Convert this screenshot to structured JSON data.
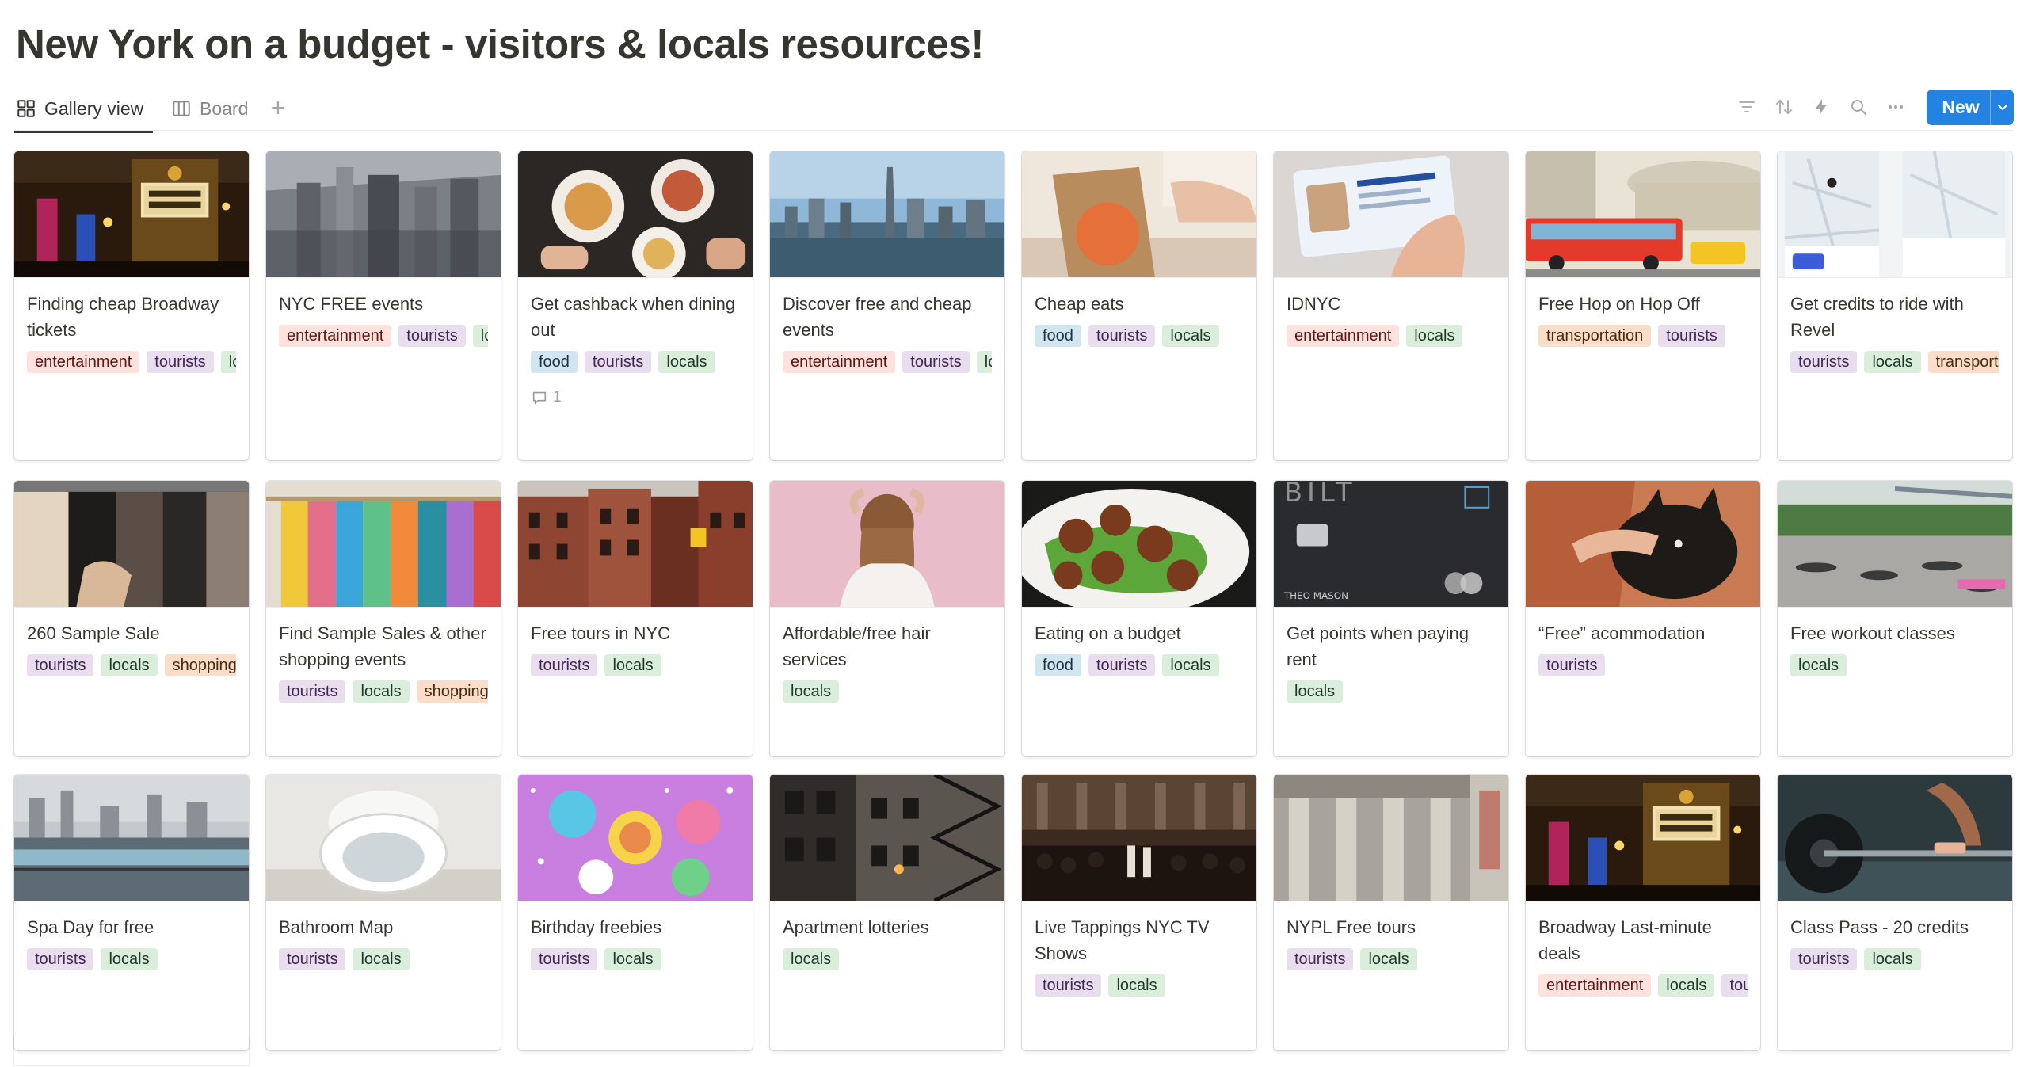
{
  "page": {
    "title": "New York on a budget - visitors & locals resources!"
  },
  "views": {
    "tabs": [
      {
        "label": "Gallery view",
        "icon": "gallery-icon",
        "active": true
      },
      {
        "label": "Board",
        "icon": "board-icon",
        "active": false
      }
    ],
    "add_icon": "plus-icon"
  },
  "toolbar": {
    "icons": [
      "filter-icon",
      "sort-icon",
      "lightning-icon",
      "search-icon",
      "more-icon"
    ],
    "new_label": "New",
    "new_caret_icon": "chevron-down-icon"
  },
  "tag_colors": {
    "entertainment": {
      "bg": "#ffe2dd",
      "fg": "#5d1715"
    },
    "tourists": {
      "bg": "#e8deee",
      "fg": "#412454"
    },
    "locals": {
      "bg": "#dbeddb",
      "fg": "#1c3829"
    },
    "food": {
      "bg": "#d3e5ef",
      "fg": "#183347"
    },
    "transportation": {
      "bg": "#fadec9",
      "fg": "#49290e"
    },
    "shopping": {
      "bg": "#fadec9",
      "fg": "#49290e"
    }
  },
  "cards": [
    {
      "title": "Finding cheap Broadway tickets",
      "tags": [
        "entertainment",
        "tourists",
        "locals"
      ],
      "cover": "broadway-marquee-photo"
    },
    {
      "title": "NYC FREE events",
      "tags": [
        "entertainment",
        "tourists",
        "locals"
      ],
      "cover": "manhattan-aerial-photo"
    },
    {
      "title": "Get cashback when dining out",
      "tags": [
        "food",
        "tourists",
        "locals"
      ],
      "cover": "dining-table-photo",
      "comment_count": "1"
    },
    {
      "title": "Discover free and cheap events",
      "tags": [
        "entertainment",
        "tourists",
        "locals"
      ],
      "cover": "skyline-photo"
    },
    {
      "title": "Cheap eats",
      "tags": [
        "food",
        "tourists",
        "locals"
      ],
      "cover": "takeout-bag-photo"
    },
    {
      "title": "IDNYC",
      "tags": [
        "entertainment",
        "locals"
      ],
      "cover": "id-card-photo"
    },
    {
      "title": "Free Hop on Hop Off",
      "tags": [
        "transportation",
        "tourists"
      ],
      "cover": "tour-bus-photo"
    },
    {
      "title": "Get credits to ride with Revel",
      "tags": [
        "tourists",
        "locals",
        "transportation"
      ],
      "cover": "app-screens-photo"
    },
    {
      "title": "260 Sample Sale",
      "tags": [
        "tourists",
        "locals",
        "shopping"
      ],
      "cover": "clothing-rack-photo"
    },
    {
      "title": "Find Sample Sales & other shopping events",
      "tags": [
        "tourists",
        "locals",
        "shopping"
      ],
      "cover": "colorful-rack-photo"
    },
    {
      "title": "Free tours in NYC",
      "tags": [
        "tourists",
        "locals"
      ],
      "cover": "brick-buildings-photo"
    },
    {
      "title": "Affordable/free hair services",
      "tags": [
        "locals"
      ],
      "cover": "hair-photo"
    },
    {
      "title": "Eating on a budget",
      "tags": [
        "food",
        "tourists",
        "locals"
      ],
      "cover": "meatballs-photo"
    },
    {
      "title": "Get points when paying rent",
      "tags": [
        "locals"
      ],
      "cover": "bilt-card-photo"
    },
    {
      "title": "“Free” acommodation",
      "tags": [
        "tourists"
      ],
      "cover": "dog-photo"
    },
    {
      "title": "Free workout classes",
      "tags": [
        "locals"
      ],
      "cover": "outdoor-workout-photo"
    },
    {
      "title": "Spa Day for free",
      "tags": [
        "tourists",
        "locals"
      ],
      "cover": "rooftop-pool-photo"
    },
    {
      "title": "Bathroom Map",
      "tags": [
        "tourists",
        "locals"
      ],
      "cover": "toilet-photo"
    },
    {
      "title": "Birthday freebies",
      "tags": [
        "tourists",
        "locals"
      ],
      "cover": "party-table-photo"
    },
    {
      "title": "Apartment lotteries",
      "tags": [
        "locals"
      ],
      "cover": "fire-escape-photo"
    },
    {
      "title": "Live Tappings NYC TV Shows",
      "tags": [
        "tourists",
        "locals"
      ],
      "cover": "theater-audience-photo"
    },
    {
      "title": "NYPL Free tours",
      "tags": [
        "tourists",
        "locals"
      ],
      "cover": "library-columns-photo"
    },
    {
      "title": "Broadway Last-minute deals",
      "tags": [
        "entertainment",
        "locals",
        "tourists"
      ],
      "cover": "broadway-marquee-photo"
    },
    {
      "title": "Class Pass - 20 credits",
      "tags": [
        "tourists",
        "locals"
      ],
      "cover": "barbell-photo"
    }
  ]
}
